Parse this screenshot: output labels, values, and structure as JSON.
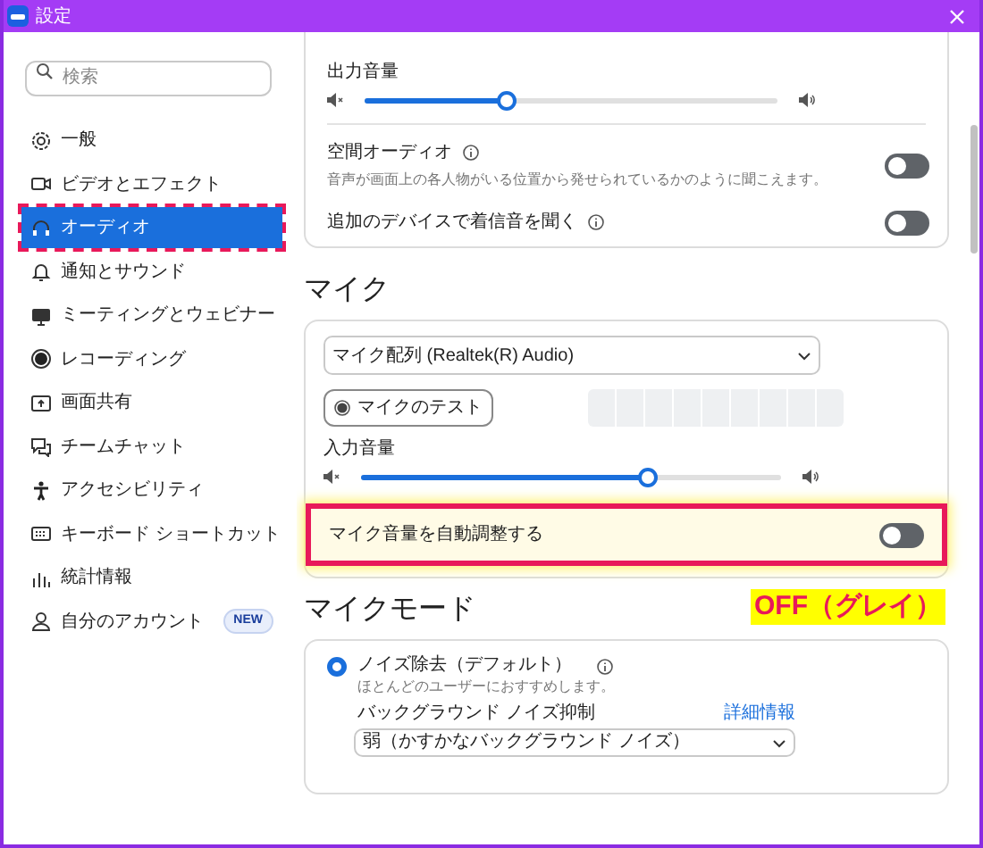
{
  "window": {
    "title": "設定"
  },
  "sidebar": {
    "search": {
      "placeholder": "検索"
    },
    "items": [
      {
        "label": "一般",
        "selected": false
      },
      {
        "label": "ビデオとエフェクト",
        "selected": false
      },
      {
        "label": "オーディオ",
        "selected": true
      },
      {
        "label": "通知とサウンド",
        "selected": false
      },
      {
        "label": "ミーティングとウェビナー",
        "selected": false
      },
      {
        "label": "レコーディング",
        "selected": false
      },
      {
        "label": "画面共有",
        "selected": false
      },
      {
        "label": "チームチャット",
        "selected": false
      },
      {
        "label": "アクセシビリティ",
        "selected": false
      },
      {
        "label": "キーボード ショートカット",
        "selected": false
      },
      {
        "label": "統計情報",
        "selected": false
      },
      {
        "label": "自分のアカウント",
        "selected": false,
        "badge": "NEW"
      }
    ]
  },
  "output": {
    "label": "出力音量",
    "level": 0.34
  },
  "toggles": [
    {
      "label": "空間オーディオ",
      "info": true,
      "description": "音声が画面上の各人物がいる位置から発せられているかのように聞こえます。",
      "on": false
    },
    {
      "label": "追加のデバイスで着信音を聞く",
      "info": true,
      "on": false
    }
  ],
  "mic": {
    "heading": "マイク",
    "device": "マイク配列 (Realtek(R) Audio)",
    "test_button": "マイクのテスト",
    "input_label": "入力音量",
    "level": 0.68,
    "auto_adjust": {
      "label": "マイク音量を自動調整する",
      "on": false,
      "highlighted": true
    }
  },
  "annotation": {
    "text": "OFF（グレイ）"
  },
  "mic_mode": {
    "heading": "マイクモード",
    "options": [
      {
        "label": "ノイズ除去（デフォルト）",
        "info": true,
        "selected": true,
        "description": "ほとんどのユーザーにおすすめします。"
      }
    ],
    "noise_suppression": {
      "label": "バックグラウンド ノイズ抑制",
      "link": "詳細情報",
      "value": "弱（かすかなバックグラウンド ノイズ）"
    }
  }
}
